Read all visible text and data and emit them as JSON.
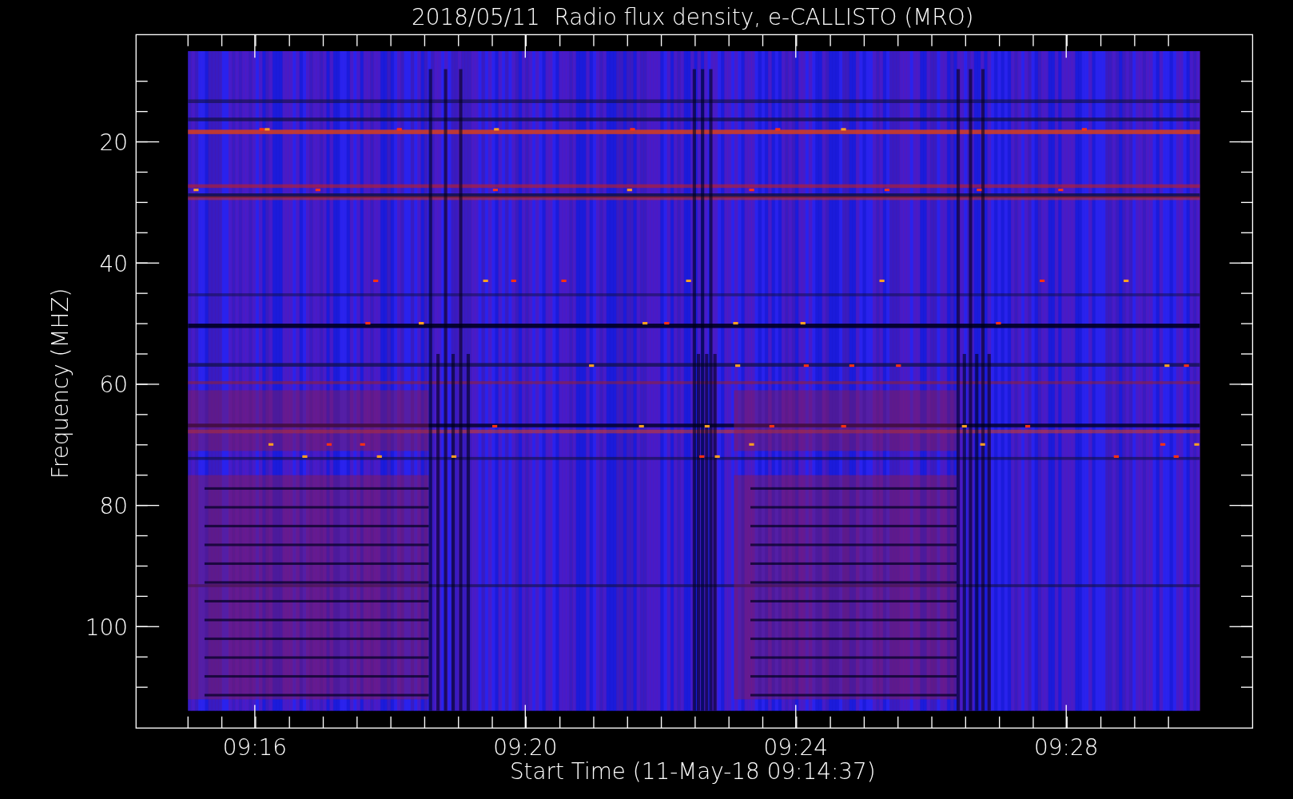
{
  "plot": {
    "title": "2018/05/11  Radio flux density, e-CALLISTO (MRO)",
    "ylabel": "Frequency (MHZ)",
    "xlabel": "Start Time (11-May-18 09:14:37)",
    "xticks": [
      "09:16",
      "09:20",
      "09:24",
      "09:28"
    ],
    "yticks": [
      "20",
      "40",
      "60",
      "80",
      "100"
    ]
  }
}
